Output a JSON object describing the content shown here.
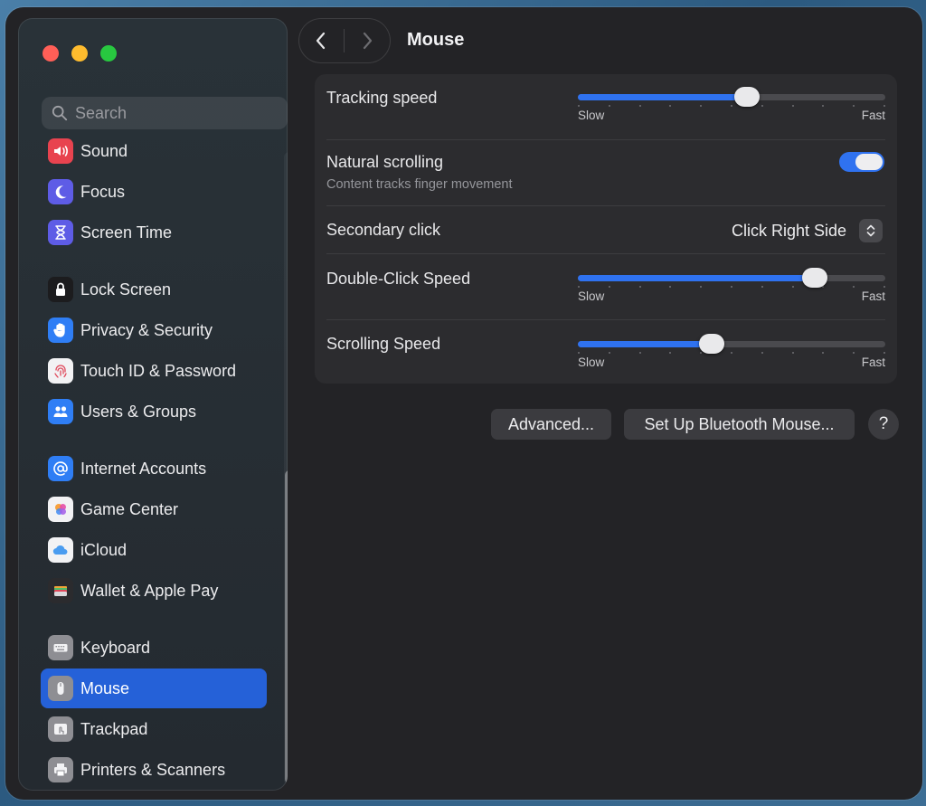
{
  "sidebar": {
    "search": {
      "placeholder": "Search"
    },
    "items": [
      {
        "label": "Sound",
        "icon": "speaker-icon",
        "color": "#e8434f"
      },
      {
        "label": "Focus",
        "icon": "moon-icon",
        "color": "#5e5ce6"
      },
      {
        "label": "Screen Time",
        "icon": "hourglass-icon",
        "color": "#5e5ce6"
      },
      {
        "label": "Lock Screen",
        "icon": "lock-icon",
        "color": "#1c1c1e"
      },
      {
        "label": "Privacy & Security",
        "icon": "hand-icon",
        "color": "#2f7ef5"
      },
      {
        "label": "Touch ID & Password",
        "icon": "fingerprint-icon",
        "color": "#f2f2f4"
      },
      {
        "label": "Users & Groups",
        "icon": "users-icon",
        "color": "#2f7ef5"
      },
      {
        "label": "Internet Accounts",
        "icon": "at-icon",
        "color": "#2f7ef5"
      },
      {
        "label": "Game Center",
        "icon": "game-center-icon",
        "color": "#f2f2f4"
      },
      {
        "label": "iCloud",
        "icon": "cloud-icon",
        "color": "#f2f2f4"
      },
      {
        "label": "Wallet & Apple Pay",
        "icon": "wallet-icon",
        "color": "#2b2b2e"
      },
      {
        "label": "Keyboard",
        "icon": "keyboard-icon",
        "color": "#8e8e93"
      },
      {
        "label": "Mouse",
        "icon": "mouse-icon",
        "color": "#8e8e93",
        "selected": true
      },
      {
        "label": "Trackpad",
        "icon": "trackpad-icon",
        "color": "#8e8e93"
      },
      {
        "label": "Printers & Scanners",
        "icon": "printer-icon",
        "color": "#8e8e93"
      }
    ]
  },
  "header": {
    "title": "Mouse"
  },
  "settings": {
    "tracking_speed": {
      "label": "Tracking speed",
      "value": 0.55,
      "min_label": "Slow",
      "max_label": "Fast"
    },
    "natural_scrolling": {
      "label": "Natural scrolling",
      "description": "Content tracks finger movement",
      "on": true
    },
    "secondary_click": {
      "label": "Secondary click",
      "value": "Click Right Side"
    },
    "double_click_speed": {
      "label": "Double-Click Speed",
      "value": 0.77,
      "min_label": "Slow",
      "max_label": "Fast"
    },
    "scrolling_speed": {
      "label": "Scrolling Speed",
      "value": 0.435,
      "min_label": "Slow",
      "max_label": "Fast"
    }
  },
  "buttons": {
    "advanced": "Advanced...",
    "bluetooth": "Set Up Bluetooth Mouse...",
    "help": "?"
  },
  "colors": {
    "accent": "#2f72f0",
    "selected_row": "#2561d8"
  }
}
